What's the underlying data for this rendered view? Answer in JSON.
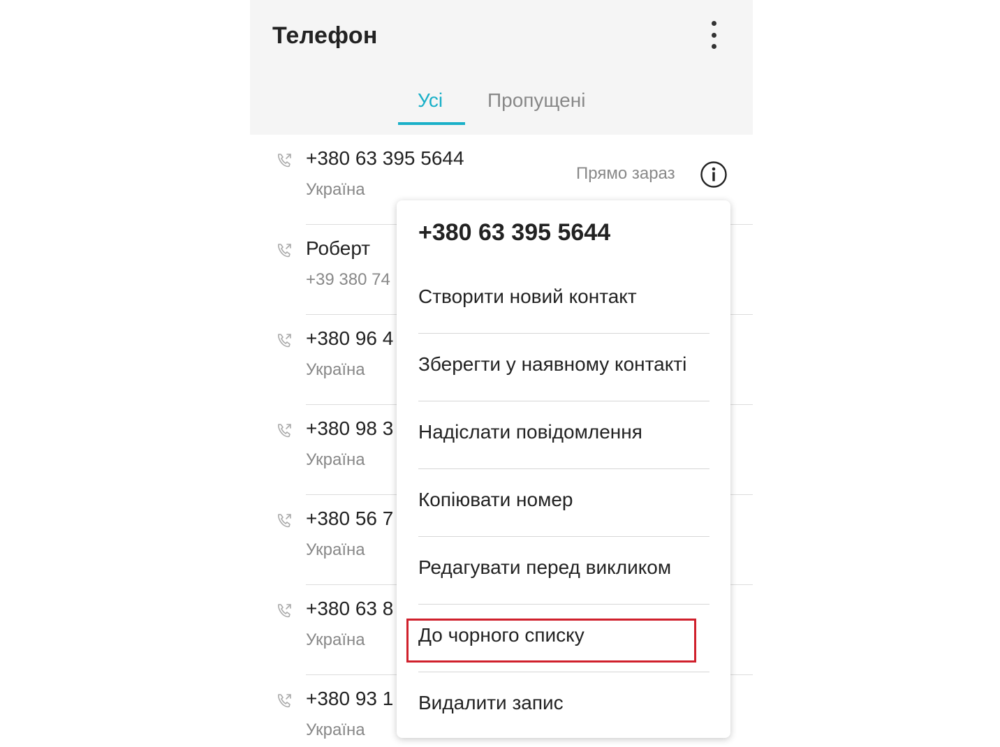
{
  "app": {
    "title": "Телефон"
  },
  "tabs": [
    {
      "label": "Усі",
      "active": true
    },
    {
      "label": "Пропущені",
      "active": false
    }
  ],
  "calls": [
    {
      "primary": "+380 63 395 5644",
      "secondary": "Україна",
      "time": "Прямо зараз"
    },
    {
      "primary": "Роберт",
      "secondary": "+39 380 74"
    },
    {
      "primary": "+380 96 4",
      "secondary": "Україна"
    },
    {
      "primary": "+380 98 3",
      "secondary": "Україна"
    },
    {
      "primary": "+380 56 7",
      "secondary": "Україна"
    },
    {
      "primary": "+380 63 8",
      "secondary": "Україна"
    },
    {
      "primary": "+380 93 1",
      "secondary": "Україна"
    }
  ],
  "context_menu": {
    "title": "+380 63 395 5644",
    "items": [
      {
        "label": "Створити новий контакт"
      },
      {
        "label": "Зберегти у наявному контакті"
      },
      {
        "label": "Надіслати повідомлення"
      },
      {
        "label": "Копіювати номер"
      },
      {
        "label": "Редагувати перед викликом"
      },
      {
        "label": "До чорного списку",
        "highlighted": true
      },
      {
        "label": "Видалити запис"
      }
    ]
  },
  "colors": {
    "accent": "#1ab0c8",
    "highlight": "#d0202c",
    "header_bg": "#f5f5f5"
  },
  "icons": {
    "overflow": "more-vert-icon",
    "call_type": "outgoing-call-icon",
    "details": "info-icon"
  }
}
